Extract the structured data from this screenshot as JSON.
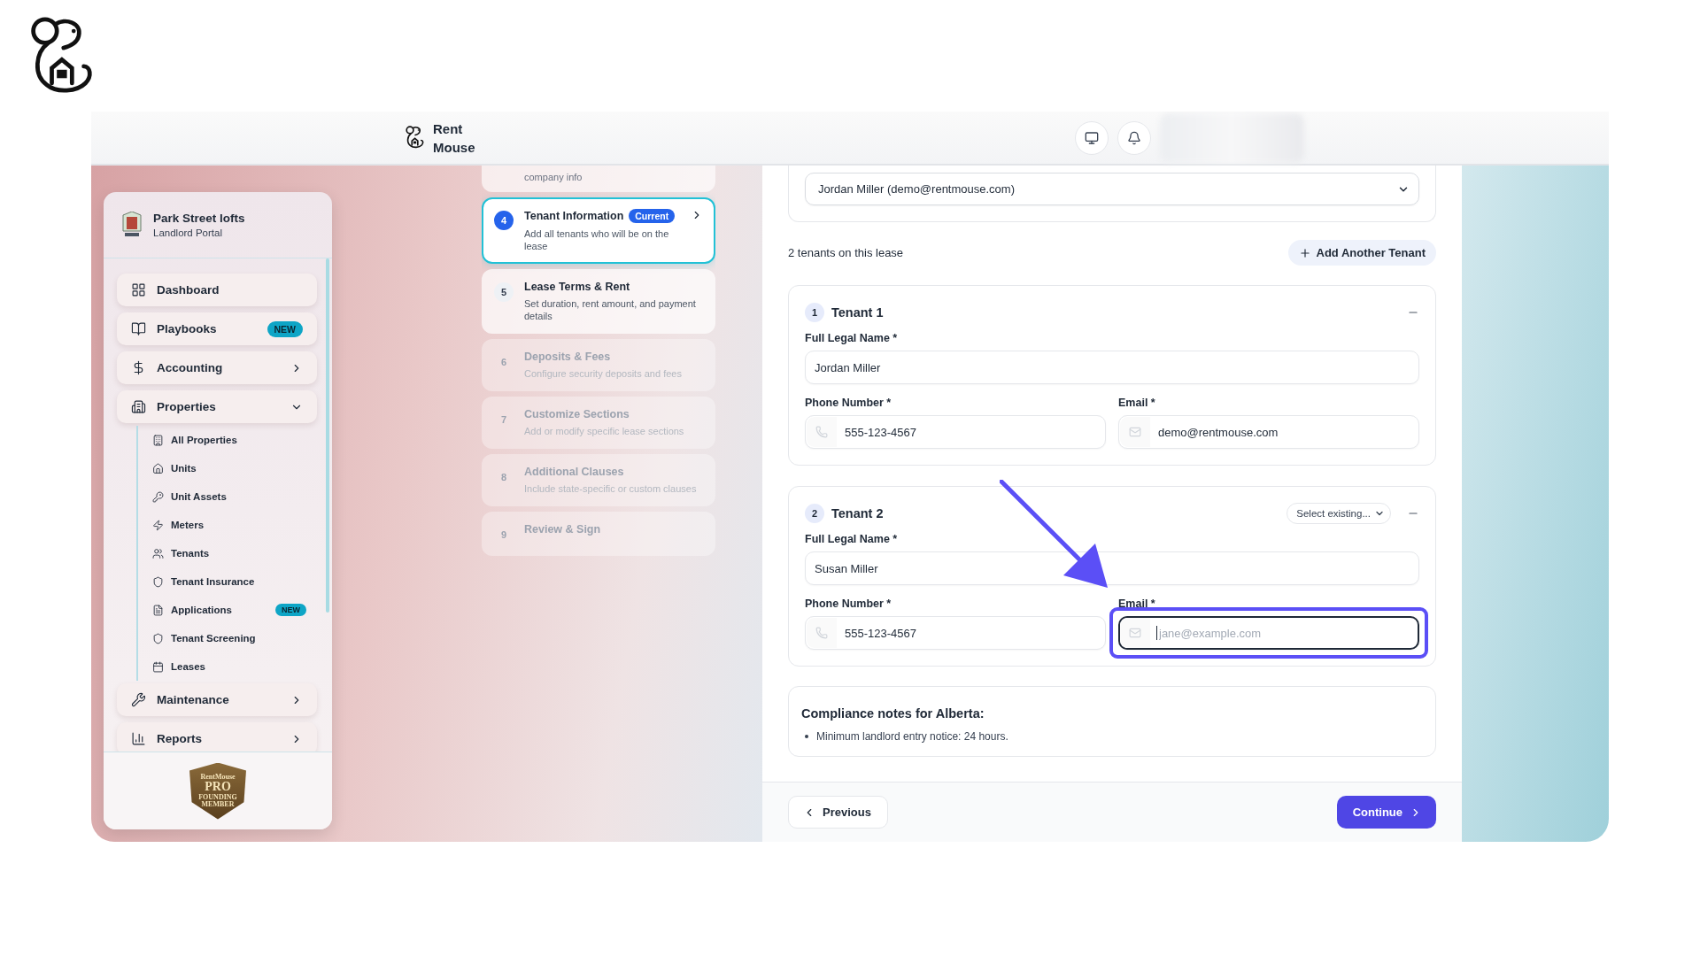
{
  "top_bar": {
    "brand_name": "Rent Mouse"
  },
  "sidebar": {
    "org_name": "Park Street lofts",
    "org_subtitle": "Landlord Portal",
    "items": [
      {
        "label": "Dashboard",
        "kind": "link"
      },
      {
        "label": "Playbooks",
        "kind": "link",
        "badge": "NEW"
      },
      {
        "label": "Accounting",
        "kind": "group",
        "expanded": false
      },
      {
        "label": "Properties",
        "kind": "group",
        "expanded": true,
        "children": [
          {
            "label": "All Properties"
          },
          {
            "label": "Units"
          },
          {
            "label": "Unit Assets"
          },
          {
            "label": "Meters"
          },
          {
            "label": "Tenants"
          },
          {
            "label": "Tenant Insurance"
          },
          {
            "label": "Applications",
            "badge": "NEW"
          },
          {
            "label": "Tenant Screening"
          },
          {
            "label": "Leases"
          }
        ]
      },
      {
        "label": "Maintenance",
        "kind": "group",
        "expanded": false
      },
      {
        "label": "Reports",
        "kind": "group",
        "expanded": false
      }
    ],
    "member_badge": {
      "lines": [
        "RentMouse",
        "PRO",
        "FOUNDING",
        "MEMBER"
      ]
    }
  },
  "steps": [
    {
      "subtitle": "company info",
      "kind": "done"
    },
    {
      "number": "4",
      "title": "Tenant Information",
      "subtitle": "Add all tenants who will be on the lease",
      "kind": "current",
      "badge": "Current"
    },
    {
      "number": "5",
      "title": "Lease Terms & Rent",
      "subtitle": "Set duration, rent amount, and payment details",
      "kind": "next"
    },
    {
      "number": "6",
      "title": "Deposits & Fees",
      "subtitle": "Configure security deposits and fees",
      "kind": "upcoming"
    },
    {
      "number": "7",
      "title": "Customize Sections",
      "subtitle": "Add or modify specific lease sections",
      "kind": "upcoming"
    },
    {
      "number": "8",
      "title": "Additional Clauses",
      "subtitle": "Include state-specific or custom clauses",
      "kind": "upcoming"
    },
    {
      "number": "9",
      "title": "Review & Sign",
      "kind": "upcoming"
    }
  ],
  "form": {
    "primary_select": {
      "value": "Jordan Miller (demo@rentmouse.com)"
    },
    "tenant_count": "2 tenants on this lease",
    "add_button": "Add Another Tenant",
    "tenants": [
      {
        "number": "1",
        "title": "Tenant 1",
        "fields": [
          {
            "kind": "text",
            "label": "Full Legal Name *",
            "value": "Jordan Miller"
          },
          {
            "kind": "phone",
            "label": "Phone Number *",
            "value": "555-123-4567"
          },
          {
            "kind": "email",
            "label": "Email *",
            "value": "demo@rentmouse.com"
          }
        ]
      },
      {
        "number": "2",
        "title": "Tenant 2",
        "select_existing": "Select existing...",
        "fields": [
          {
            "kind": "text",
            "label": "Full Legal Name *",
            "value": "Susan Miller"
          },
          {
            "kind": "phone",
            "label": "Phone Number *",
            "value": "555-123-4567"
          },
          {
            "kind": "email",
            "label": "Email *",
            "placeholder": "jane@example.com",
            "focused": true,
            "highlighted": true
          }
        ]
      }
    ],
    "compliance": {
      "title": "Compliance notes for Alberta:",
      "notes": [
        "Minimum landlord entry notice: 24 hours."
      ]
    },
    "previous_button": "Previous",
    "continue_button": "Continue"
  }
}
